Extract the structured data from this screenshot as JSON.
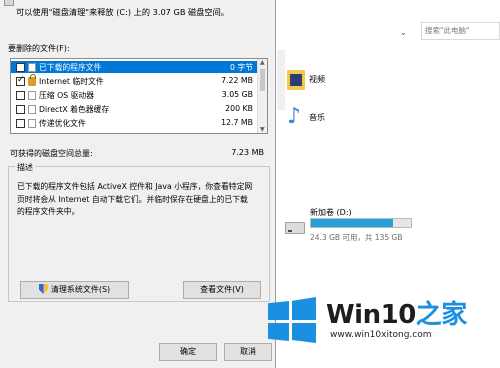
{
  "dialog": {
    "top_info": "可以使用\"磁盘清理\"来释放  (C:) 上的 3.07 GB 磁盘空间。",
    "files_label": "要删除的文件(F):",
    "files": [
      {
        "name": "已下载的程序文件",
        "size": "0 字节",
        "checked": false,
        "selected": true,
        "icon": "folder-icon"
      },
      {
        "name": "Internet 临时文件",
        "size": "7.22 MB",
        "checked": true,
        "selected": false,
        "icon": "lock-icon"
      },
      {
        "name": "压缩 OS 驱动器",
        "size": "3.05 GB",
        "checked": false,
        "selected": false,
        "icon": "document-icon"
      },
      {
        "name": "DirectX 着色器缓存",
        "size": "200 KB",
        "checked": false,
        "selected": false,
        "icon": "document-icon"
      },
      {
        "name": "传递优化文件",
        "size": "12.7 MB",
        "checked": false,
        "selected": false,
        "icon": "document-icon"
      }
    ],
    "total_label": "可获得的磁盘空间总量:",
    "total_value": "7.23 MB",
    "description_title": "描述",
    "description_lines": [
      "已下载的程序文件包括 ActiveX 控件和 Java 小程序，你查看特定网",
      "页时将会从 Internet 自动下载它们。并临时保存在硬盘上的已下载",
      "的程序文件夹中。"
    ],
    "clean_system_button": "清理系统文件(S)",
    "view_files_button": "查看文件(V)",
    "ok_button": "确定",
    "cancel_button": "取消"
  },
  "explorer": {
    "search_placeholder": "搜索\"此电脑\"",
    "libraries": [
      "视频",
      "音乐"
    ],
    "drive": {
      "name": "新加卷 (D:)",
      "stats": "24.3 GB 可用，共 135 GB",
      "used_fraction": 0.82
    }
  },
  "watermark": {
    "title_win": "Win10",
    "title_zh": "之家",
    "url": "www.win10xitong.com"
  },
  "colors": {
    "selection": "#0078d7",
    "drive_fill": "#26a0da",
    "watermark_blue": "#1b8fe0"
  }
}
